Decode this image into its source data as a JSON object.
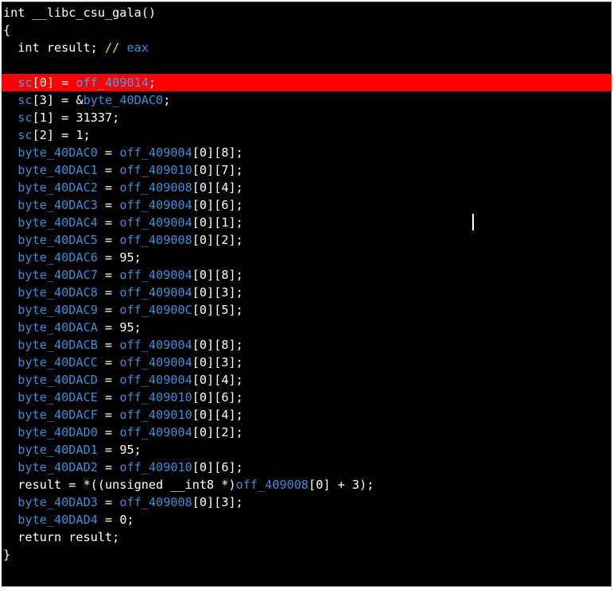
{
  "lines": [
    {
      "segments": [
        {
          "t": "plain",
          "v": "int __libc_csu_gala()"
        }
      ]
    },
    {
      "segments": [
        {
          "t": "plain",
          "v": "{"
        }
      ]
    },
    {
      "segments": [
        {
          "t": "plain",
          "v": "  int result; "
        },
        {
          "t": "comment",
          "v": "// "
        },
        {
          "t": "ident",
          "v": "eax"
        }
      ]
    },
    {
      "segments": [
        {
          "t": "plain",
          "v": ""
        }
      ]
    },
    {
      "highlight": true,
      "segments": [
        {
          "t": "plain",
          "v": "  "
        },
        {
          "t": "hlident",
          "v": "sc"
        },
        {
          "t": "plain",
          "v": "[0] = "
        },
        {
          "t": "hlident",
          "v": "off_409014"
        },
        {
          "t": "plain",
          "v": ";"
        }
      ]
    },
    {
      "segments": [
        {
          "t": "plain",
          "v": "  "
        },
        {
          "t": "ident",
          "v": "sc"
        },
        {
          "t": "plain",
          "v": "[3] = &"
        },
        {
          "t": "ident",
          "v": "byte_40DAC0"
        },
        {
          "t": "plain",
          "v": ";"
        }
      ]
    },
    {
      "segments": [
        {
          "t": "plain",
          "v": "  "
        },
        {
          "t": "ident",
          "v": "sc"
        },
        {
          "t": "plain",
          "v": "[1] = 31337;"
        }
      ]
    },
    {
      "segments": [
        {
          "t": "plain",
          "v": "  "
        },
        {
          "t": "ident",
          "v": "sc"
        },
        {
          "t": "plain",
          "v": "[2] = 1;"
        }
      ]
    },
    {
      "segments": [
        {
          "t": "plain",
          "v": "  "
        },
        {
          "t": "ident",
          "v": "byte_40DAC0"
        },
        {
          "t": "plain",
          "v": " = "
        },
        {
          "t": "ident",
          "v": "off_409004"
        },
        {
          "t": "plain",
          "v": "[0][8];"
        }
      ]
    },
    {
      "segments": [
        {
          "t": "plain",
          "v": "  "
        },
        {
          "t": "ident",
          "v": "byte_40DAC1"
        },
        {
          "t": "plain",
          "v": " = "
        },
        {
          "t": "ident",
          "v": "off_409010"
        },
        {
          "t": "plain",
          "v": "[0][7];"
        }
      ]
    },
    {
      "segments": [
        {
          "t": "plain",
          "v": "  "
        },
        {
          "t": "ident",
          "v": "byte_40DAC2"
        },
        {
          "t": "plain",
          "v": " = "
        },
        {
          "t": "ident",
          "v": "off_409008"
        },
        {
          "t": "plain",
          "v": "[0][4];"
        }
      ]
    },
    {
      "segments": [
        {
          "t": "plain",
          "v": "  "
        },
        {
          "t": "ident",
          "v": "byte_40DAC3"
        },
        {
          "t": "plain",
          "v": " = "
        },
        {
          "t": "ident",
          "v": "off_409004"
        },
        {
          "t": "plain",
          "v": "[0][6];"
        }
      ]
    },
    {
      "segments": [
        {
          "t": "plain",
          "v": "  "
        },
        {
          "t": "ident",
          "v": "byte_40DAC4"
        },
        {
          "t": "plain",
          "v": " = "
        },
        {
          "t": "ident",
          "v": "off_409004"
        },
        {
          "t": "plain",
          "v": "[0][1];"
        }
      ]
    },
    {
      "segments": [
        {
          "t": "plain",
          "v": "  "
        },
        {
          "t": "ident",
          "v": "byte_40DAC5"
        },
        {
          "t": "plain",
          "v": " = "
        },
        {
          "t": "ident",
          "v": "off_409008"
        },
        {
          "t": "plain",
          "v": "[0][2];"
        }
      ]
    },
    {
      "segments": [
        {
          "t": "plain",
          "v": "  "
        },
        {
          "t": "ident",
          "v": "byte_40DAC6"
        },
        {
          "t": "plain",
          "v": " = 95;"
        }
      ]
    },
    {
      "segments": [
        {
          "t": "plain",
          "v": "  "
        },
        {
          "t": "ident",
          "v": "byte_40DAC7"
        },
        {
          "t": "plain",
          "v": " = "
        },
        {
          "t": "ident",
          "v": "off_409004"
        },
        {
          "t": "plain",
          "v": "[0][8];"
        }
      ]
    },
    {
      "segments": [
        {
          "t": "plain",
          "v": "  "
        },
        {
          "t": "ident",
          "v": "byte_40DAC8"
        },
        {
          "t": "plain",
          "v": " = "
        },
        {
          "t": "ident",
          "v": "off_409004"
        },
        {
          "t": "plain",
          "v": "[0][3];"
        }
      ]
    },
    {
      "segments": [
        {
          "t": "plain",
          "v": "  "
        },
        {
          "t": "ident",
          "v": "byte_40DAC9"
        },
        {
          "t": "plain",
          "v": " = "
        },
        {
          "t": "ident",
          "v": "off_40900C"
        },
        {
          "t": "plain",
          "v": "[0][5];"
        }
      ]
    },
    {
      "segments": [
        {
          "t": "plain",
          "v": "  "
        },
        {
          "t": "ident",
          "v": "byte_40DACA"
        },
        {
          "t": "plain",
          "v": " = 95;"
        }
      ]
    },
    {
      "segments": [
        {
          "t": "plain",
          "v": "  "
        },
        {
          "t": "ident",
          "v": "byte_40DACB"
        },
        {
          "t": "plain",
          "v": " = "
        },
        {
          "t": "ident",
          "v": "off_409004"
        },
        {
          "t": "plain",
          "v": "[0][8];"
        }
      ]
    },
    {
      "segments": [
        {
          "t": "plain",
          "v": "  "
        },
        {
          "t": "ident",
          "v": "byte_40DACC"
        },
        {
          "t": "plain",
          "v": " = "
        },
        {
          "t": "ident",
          "v": "off_409004"
        },
        {
          "t": "plain",
          "v": "[0][3];"
        }
      ]
    },
    {
      "segments": [
        {
          "t": "plain",
          "v": "  "
        },
        {
          "t": "ident",
          "v": "byte_40DACD"
        },
        {
          "t": "plain",
          "v": " = "
        },
        {
          "t": "ident",
          "v": "off_409004"
        },
        {
          "t": "plain",
          "v": "[0][4];"
        }
      ]
    },
    {
      "segments": [
        {
          "t": "plain",
          "v": "  "
        },
        {
          "t": "ident",
          "v": "byte_40DACE"
        },
        {
          "t": "plain",
          "v": " = "
        },
        {
          "t": "ident",
          "v": "off_409010"
        },
        {
          "t": "plain",
          "v": "[0][6];"
        }
      ]
    },
    {
      "segments": [
        {
          "t": "plain",
          "v": "  "
        },
        {
          "t": "ident",
          "v": "byte_40DACF"
        },
        {
          "t": "plain",
          "v": " = "
        },
        {
          "t": "ident",
          "v": "off_409010"
        },
        {
          "t": "plain",
          "v": "[0][4];"
        }
      ]
    },
    {
      "segments": [
        {
          "t": "plain",
          "v": "  "
        },
        {
          "t": "ident",
          "v": "byte_40DAD0"
        },
        {
          "t": "plain",
          "v": " = "
        },
        {
          "t": "ident",
          "v": "off_409004"
        },
        {
          "t": "plain",
          "v": "[0][2];"
        }
      ]
    },
    {
      "segments": [
        {
          "t": "plain",
          "v": "  "
        },
        {
          "t": "ident",
          "v": "byte_40DAD1"
        },
        {
          "t": "plain",
          "v": " = 95;"
        }
      ]
    },
    {
      "segments": [
        {
          "t": "plain",
          "v": "  "
        },
        {
          "t": "ident",
          "v": "byte_40DAD2"
        },
        {
          "t": "plain",
          "v": " = "
        },
        {
          "t": "ident",
          "v": "off_409010"
        },
        {
          "t": "plain",
          "v": "[0][6];"
        }
      ]
    },
    {
      "segments": [
        {
          "t": "plain",
          "v": "  result = *((unsigned __int8 *)"
        },
        {
          "t": "ident",
          "v": "off_409008"
        },
        {
          "t": "plain",
          "v": "[0] + 3);"
        }
      ]
    },
    {
      "segments": [
        {
          "t": "plain",
          "v": "  "
        },
        {
          "t": "ident",
          "v": "byte_40DAD3"
        },
        {
          "t": "plain",
          "v": " = "
        },
        {
          "t": "ident",
          "v": "off_409008"
        },
        {
          "t": "plain",
          "v": "[0][3];"
        }
      ]
    },
    {
      "segments": [
        {
          "t": "plain",
          "v": "  "
        },
        {
          "t": "ident",
          "v": "byte_40DAD4"
        },
        {
          "t": "plain",
          "v": " = 0;"
        }
      ]
    },
    {
      "segments": [
        {
          "t": "plain",
          "v": "  return result;"
        }
      ]
    },
    {
      "segments": [
        {
          "t": "plain",
          "v": "}"
        }
      ]
    }
  ],
  "colors": {
    "background": "#000000",
    "text": "#ffffff",
    "identifier": "#3c8dd6",
    "comment": "#e7e700",
    "highlight_line": "#ff0000"
  }
}
